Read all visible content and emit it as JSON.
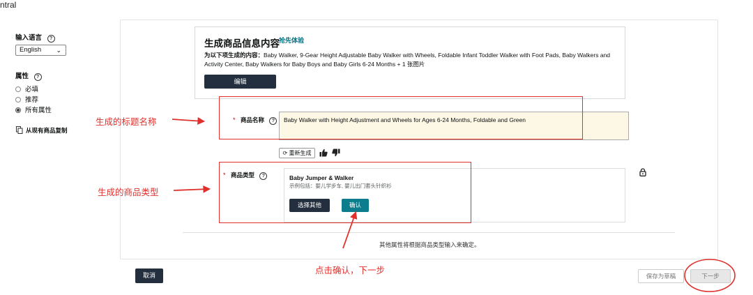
{
  "header": {
    "title": "ntral"
  },
  "sidebar": {
    "language_label": "输入语言",
    "language_value": "English",
    "attributes_label": "属性",
    "radios": [
      {
        "label": "必填",
        "checked": false
      },
      {
        "label": "推荐",
        "checked": false
      },
      {
        "label": "所有属性",
        "checked": true
      }
    ],
    "copy_link": "从现有商品复制"
  },
  "generator": {
    "title": "生成商品信息内容",
    "badge": "抢先体验",
    "desc_prefix": "为以下项生成的内容：",
    "desc_text": "Baby Walker, 9-Gear Height Adjustable Baby Walker with Wheels, Foldable Infant Toddler Walker with Foot Pads, Baby Walkers and Activity Center, Baby Walkers for Baby Boys and Baby Girls 6-24 Months + 1 张图片",
    "edit_label": "编辑"
  },
  "fields": {
    "name_label": "商品名称",
    "name_value": "Baby Walker with Height Adjustment and Wheels for Ages 6-24 Months, Foldable and Green",
    "regen_label": "重新生成",
    "type_label": "商品类型",
    "type_name": "Baby Jumper & Walker",
    "type_example": "示例包括：婴儿学步车, 婴儿出门套头针织衫",
    "choose_other_label": "选择其他",
    "confirm_label": "确认",
    "note": "其他属性将根据商品类型输入来确定。"
  },
  "footer": {
    "cancel_label": "取消",
    "save_draft_label": "保存为草稿",
    "next_label": "下一步"
  },
  "annotations": {
    "title_note": "生成的标题名称",
    "type_note": "生成的商品类型",
    "confirm_note": "点击确认，下一步"
  },
  "colors": {
    "annotation": "#e0302c",
    "primary_dark": "#232f3e",
    "teal": "#0b7d8c",
    "link": "#007185"
  }
}
